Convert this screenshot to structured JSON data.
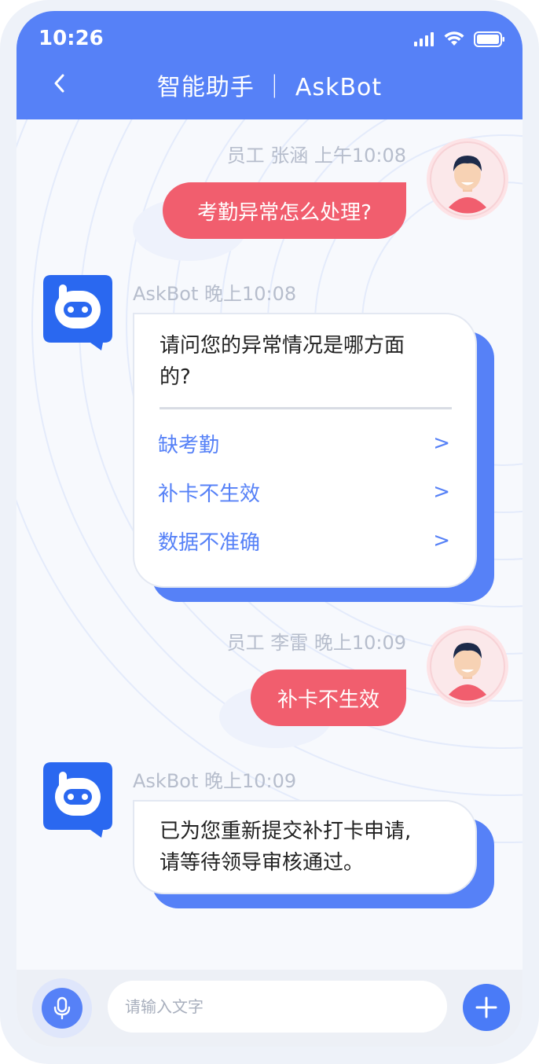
{
  "status_bar": {
    "time": "10:26"
  },
  "header": {
    "title": "智能助手 ｜ AskBot"
  },
  "messages": [
    {
      "sender": "员工 张涵 上午10:08",
      "text": "考勤异常怎么处理?"
    },
    {
      "sender": "AskBot 晚上10:08",
      "text_lines": [
        "请问您的异常情况是哪方面",
        "的?"
      ],
      "options": [
        {
          "label": "缺考勤",
          "arrow": ">"
        },
        {
          "label": "补卡不生效",
          "arrow": ">"
        },
        {
          "label": "数据不准确",
          "arrow": ">"
        }
      ]
    },
    {
      "sender": "员工 李雷 晚上10:09",
      "text": "补卡不生效"
    },
    {
      "sender": "AskBot 晚上10:09",
      "text_lines": [
        "已为您重新提交补打卡申请,",
        "请等待领导审核通过。"
      ]
    }
  ],
  "input": {
    "placeholder": "请输入文字"
  },
  "icons": {
    "back": "chevron-left-icon",
    "signal": "signal-icon",
    "wifi": "wifi-icon",
    "battery": "battery-icon",
    "mic": "microphone-icon",
    "plus": "plus-icon",
    "bot_avatar": "askbot-logo-icon",
    "user_avatar": "user-avatar-icon"
  },
  "colors": {
    "primary": "#5681f7",
    "user_bubble": "#f15e6e",
    "meta_text": "#b6bdcc"
  }
}
